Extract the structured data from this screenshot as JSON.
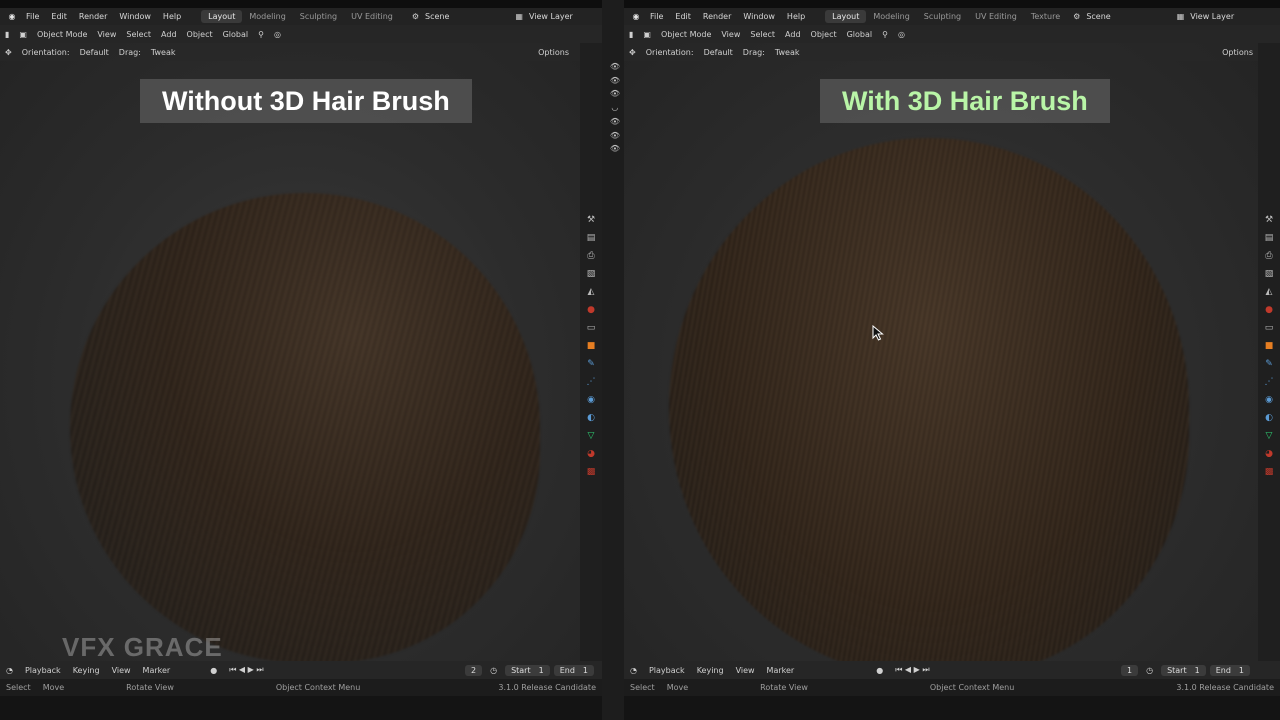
{
  "menu": {
    "items": [
      "File",
      "Edit",
      "Render",
      "Window",
      "Help"
    ]
  },
  "left": {
    "workspaces": [
      "Layout",
      "Modeling",
      "Sculpting",
      "UV Editing"
    ],
    "scene": "Scene",
    "view_layer": "View Layer",
    "header": {
      "mode": "Object Mode",
      "view": "View",
      "select": "Select",
      "add": "Add",
      "object": "Object",
      "transform": "Global"
    },
    "tool": {
      "orientation_label": "Orientation:",
      "orientation_value": "Default",
      "drag_label": "Drag:",
      "drag_value": "Tweak",
      "options": "Options"
    },
    "title": "Without 3D Hair Brush",
    "timeline": {
      "playback": "Playback",
      "keying": "Keying",
      "view": "View",
      "marker": "Marker",
      "frame": "2",
      "start_label": "Start",
      "start": "1",
      "end_label": "End",
      "end": "1"
    },
    "status": {
      "select": "Select",
      "move": "Move",
      "rotate": "Rotate View",
      "context": "Object Context Menu",
      "version": "3.1.0 Release Candidate"
    }
  },
  "right": {
    "workspaces": [
      "Layout",
      "Modeling",
      "Sculpting",
      "UV Editing",
      "Texture"
    ],
    "scene": "Scene",
    "view_layer": "View Layer",
    "header": {
      "mode": "Object Mode",
      "view": "View",
      "select": "Select",
      "add": "Add",
      "object": "Object",
      "transform": "Global"
    },
    "tool": {
      "orientation_label": "Orientation:",
      "orientation_value": "Default",
      "drag_label": "Drag:",
      "drag_value": "Tweak",
      "options": "Options"
    },
    "title": "With 3D Hair Brush",
    "timeline": {
      "playback": "Playback",
      "keying": "Keying",
      "view": "View",
      "marker": "Marker",
      "frame": "1",
      "start_label": "Start",
      "start": "1",
      "end_label": "End",
      "end": "1"
    },
    "status": {
      "select": "Select",
      "move": "Move",
      "rotate": "Rotate View",
      "context": "Object Context Menu",
      "version": "3.1.0 Release Candidate"
    }
  },
  "watermark": "VFX GRACE",
  "colors": {
    "title_left": "#ffffff",
    "title_right": "#b9f5a7",
    "active_tab": "#3a3a3a",
    "selected_blue": "#4772b3"
  }
}
